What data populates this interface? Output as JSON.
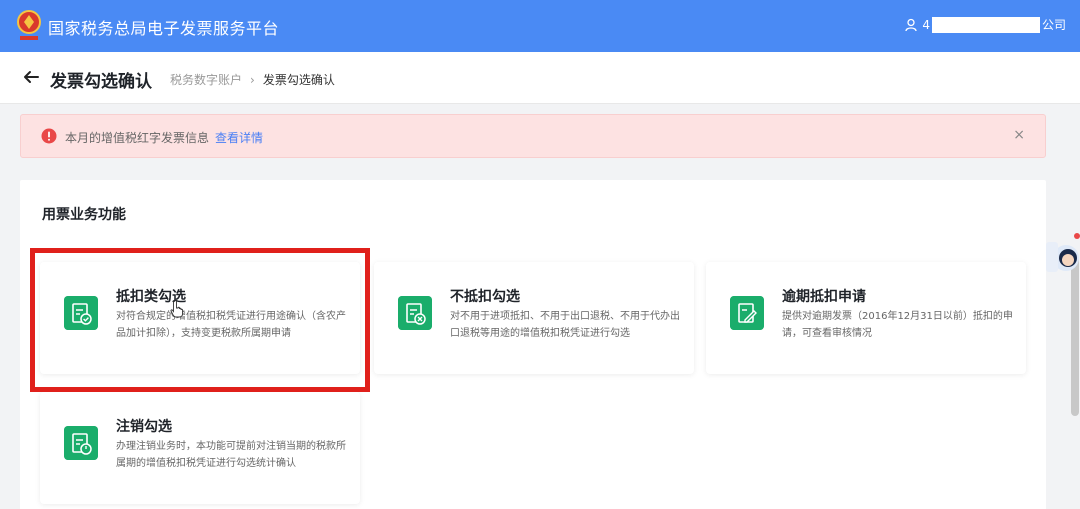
{
  "topbar": {
    "title": "国家税务总局电子发票服务平台",
    "user_prefix": "4",
    "user_suffix": "公司",
    "brand_color": "#4a8af4"
  },
  "header": {
    "page_title": "发票勾选确认",
    "breadcrumb": [
      "税务数字账户",
      "发票勾选确认"
    ]
  },
  "alert": {
    "text": "本月的增值税红字发票信息",
    "link": "查看详情",
    "close": "×"
  },
  "section": {
    "title": "用票业务功能",
    "cards": [
      {
        "title": "抵扣类勾选",
        "desc": "对符合规定的增值税扣税凭证进行用途确认（含农产品加计扣除），支持变更税款所属期申请",
        "icon": "check-document-icon"
      },
      {
        "title": "不抵扣勾选",
        "desc": "对不用于进项抵扣、不用于出口退税、不用于代办出口退税等用途的增值税扣税凭证进行勾选",
        "icon": "cross-document-icon"
      },
      {
        "title": "逾期抵扣申请",
        "desc": "提供对逾期发票（2016年12月31日以前）抵扣的申请，可查看审核情况",
        "icon": "edit-document-icon"
      },
      {
        "title": "注销勾选",
        "desc": "办理注销业务时，本功能可提前对注销当期的税款所属期的增值税扣税凭证进行勾选统计确认",
        "icon": "power-document-icon"
      }
    ]
  },
  "colors": {
    "accent_green": "#1aad6b",
    "highlight_red": "#e0201b",
    "alert_bg": "#fde2e2"
  }
}
